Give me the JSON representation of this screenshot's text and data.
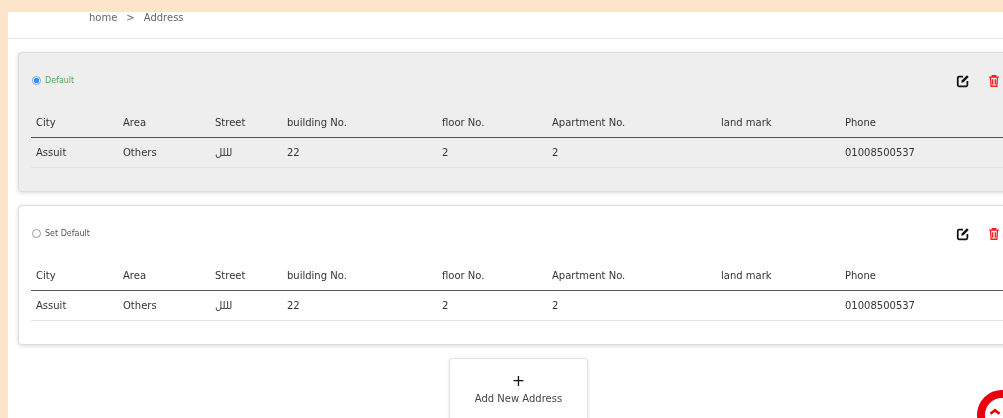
{
  "breadcrumb": {
    "items": [
      "home",
      "Address"
    ],
    "separator": ">"
  },
  "addresses": [
    {
      "selected": true,
      "default_label": "Default",
      "columns": [
        "City",
        "Area",
        "Street",
        "building No.",
        "floor No.",
        "Apartment No.",
        "land mark",
        "Phone"
      ],
      "row": {
        "city": "Assuit",
        "area": "Others",
        "street": "لللل",
        "building_no": "22",
        "floor_no": "2",
        "apartment_no": "2",
        "phone": "01008500537"
      }
    },
    {
      "selected": false,
      "default_label": "Set Default",
      "columns": [
        "City",
        "Area",
        "Street",
        "building No.",
        "floor No.",
        "Apartment No.",
        "land mark",
        "Phone"
      ],
      "row": {
        "city": "Assuit",
        "area": "Others",
        "street": "لللل",
        "building_no": "22",
        "floor_no": "2",
        "apartment_no": "2",
        "phone": "01008500537"
      }
    }
  ],
  "add_button": {
    "icon": "+",
    "label": "Add New Address"
  }
}
